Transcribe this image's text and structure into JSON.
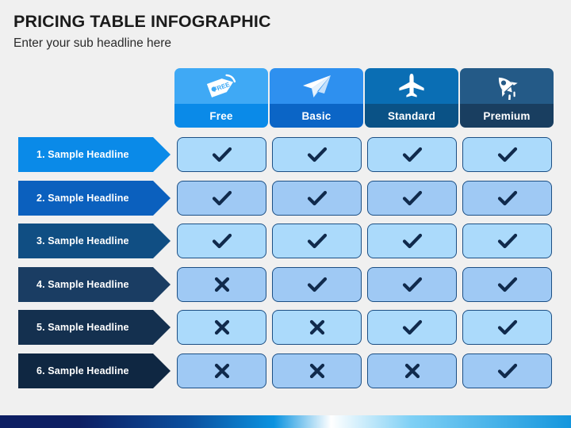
{
  "heading": {
    "title": "PRICING TABLE INFOGRAPHIC",
    "subtitle": "Enter your sub headline here"
  },
  "columns": [
    {
      "label": "Free",
      "icon": "price-tag-icon",
      "icon_text": "FREE",
      "icon_bg": "#3FA9F5",
      "label_bg": "#0A8AE8"
    },
    {
      "label": "Basic",
      "icon": "paper-plane-icon",
      "icon_text": "",
      "icon_bg": "#2E90EF",
      "label_bg": "#0B65C6"
    },
    {
      "label": "Standard",
      "icon": "airplane-icon",
      "icon_text": "",
      "icon_bg": "#0A6EB4",
      "label_bg": "#0A5286"
    },
    {
      "label": "Premium",
      "icon": "rocket-icon",
      "icon_text": "",
      "icon_bg": "#245A87",
      "label_bg": "#193E60"
    }
  ],
  "rows": [
    {
      "label": "1. Sample Headline",
      "arrow_bg": "#0A8AE8",
      "cell_bg": "#ABDAFB",
      "values": [
        "check",
        "check",
        "check",
        "check"
      ]
    },
    {
      "label": "2. Sample Headline",
      "arrow_bg": "#0B60BE",
      "cell_bg": "#9FC9F4",
      "values": [
        "check",
        "check",
        "check",
        "check"
      ]
    },
    {
      "label": "3. Sample Headline",
      "arrow_bg": "#104E83",
      "cell_bg": "#ABDAFB",
      "values": [
        "check",
        "check",
        "check",
        "check"
      ]
    },
    {
      "label": "4. Sample Headline",
      "arrow_bg": "#1A3D63",
      "cell_bg": "#9FC9F4",
      "values": [
        "cross",
        "check",
        "check",
        "check"
      ]
    },
    {
      "label": "5. Sample Headline",
      "arrow_bg": "#14304F",
      "cell_bg": "#ABDAFB",
      "values": [
        "cross",
        "cross",
        "check",
        "check"
      ]
    },
    {
      "label": "6. Sample Headline",
      "arrow_bg": "#0F2742",
      "cell_bg": "#9FC9F4",
      "values": [
        "cross",
        "cross",
        "cross",
        "check"
      ]
    }
  ],
  "colors": {
    "background": "#F0F0F0",
    "mark": "#102A4C",
    "cell_border": "#1C4F84",
    "title": "#1B1B1B"
  },
  "icons": {
    "check": "check-icon",
    "cross": "cross-icon"
  }
}
